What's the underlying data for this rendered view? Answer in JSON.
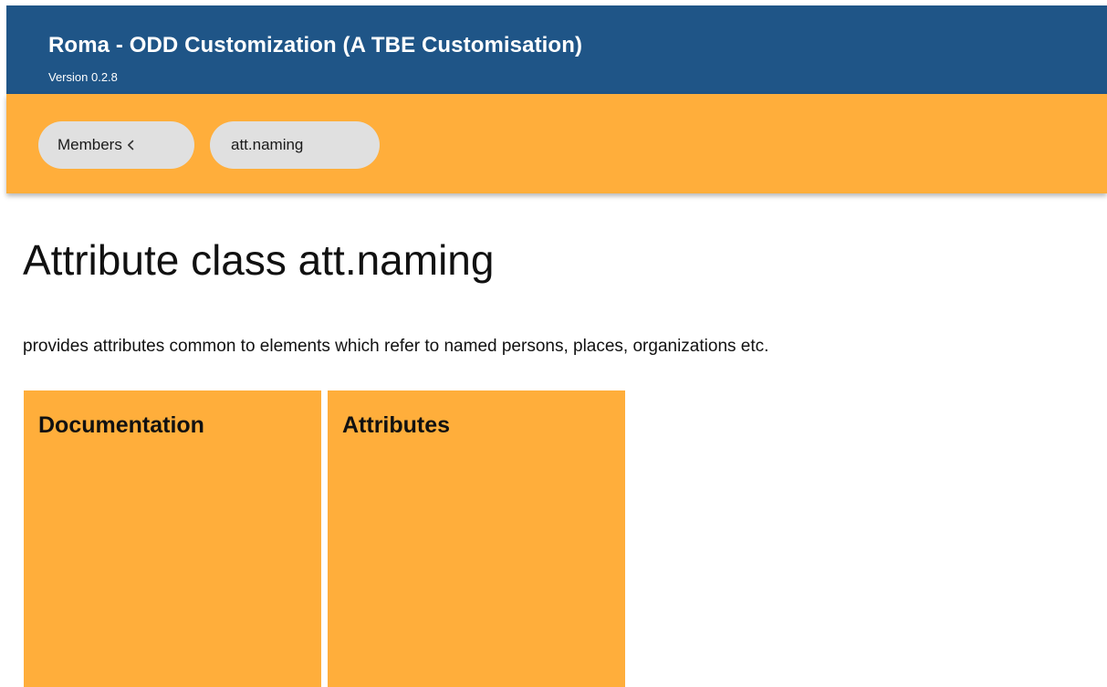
{
  "header": {
    "title": "Roma - ODD Customization (A TBE Customisation)",
    "version": "Version 0.2.8",
    "background_color": "#1f5587"
  },
  "toolbar": {
    "background_color": "#ffae3b",
    "breadcrumbs": [
      {
        "label": "Members",
        "icon": "chevron-left-icon"
      },
      {
        "label": "att.naming"
      }
    ]
  },
  "main": {
    "title": "Attribute class att.naming",
    "description": "provides attributes common to elements which refer to named persons, places, organizations etc.",
    "cards": [
      {
        "title": "Documentation"
      },
      {
        "title": "Attributes"
      }
    ],
    "card_color": "#ffae3b"
  }
}
